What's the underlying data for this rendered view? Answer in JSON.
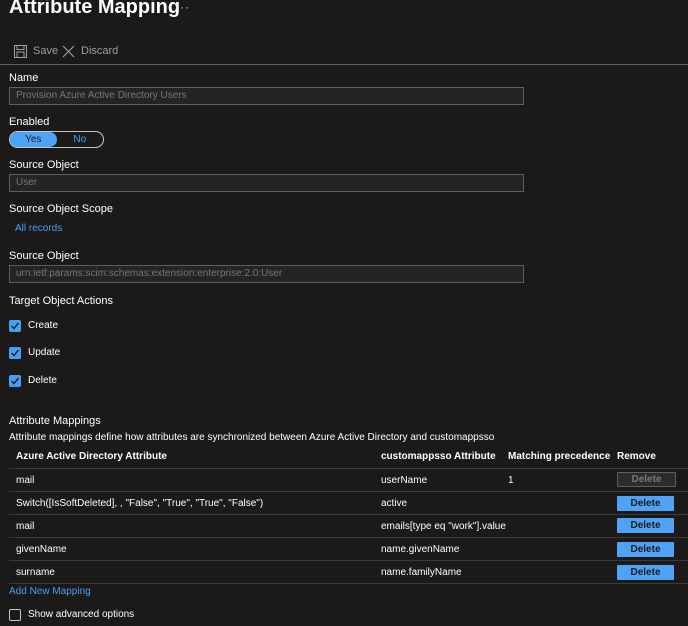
{
  "header": {
    "title": "Attribute Mapping",
    "more": "···"
  },
  "toolbar": {
    "save_label": "Save",
    "discard_label": "Discard"
  },
  "form": {
    "name": {
      "label": "Name",
      "value": "Provision Azure Active Directory Users"
    },
    "enabled": {
      "label": "Enabled",
      "yes": "Yes",
      "no": "No",
      "selected": "Yes"
    },
    "source_object": {
      "label": "Source Object",
      "value": "User"
    },
    "scope": {
      "label": "Source Object Scope",
      "link": "All records"
    },
    "target_object": {
      "label": "Source Object",
      "value": "urn:ietf:params:scim:schemas:extension:enterprise:2.0:User"
    },
    "actions": {
      "label": "Target Object Actions",
      "items": [
        {
          "label": "Create",
          "checked": true
        },
        {
          "label": "Update",
          "checked": true
        },
        {
          "label": "Delete",
          "checked": true
        }
      ]
    }
  },
  "mappings": {
    "heading": "Attribute Mappings",
    "description": "Attribute mappings define how attributes are synchronized between Azure Active Directory and customappsso",
    "columns": [
      "Azure Active Directory Attribute",
      "customappsso Attribute",
      "Matching precedence",
      "Remove"
    ],
    "rows": [
      {
        "source": "mail",
        "target": "userName",
        "precedence": "1",
        "action": "Delete",
        "disabled": true
      },
      {
        "source": "Switch([IsSoftDeleted], , \"False\", \"True\", \"True\", \"False\")",
        "target": "active",
        "precedence": "",
        "action": "Delete",
        "disabled": false
      },
      {
        "source": "mail",
        "target": "emails[type eq \"work\"].value",
        "precedence": "",
        "action": "Delete",
        "disabled": false
      },
      {
        "source": "givenName",
        "target": "name.givenName",
        "precedence": "",
        "action": "Delete",
        "disabled": false
      },
      {
        "source": "surname",
        "target": "name.familyName",
        "precedence": "",
        "action": "Delete",
        "disabled": false
      }
    ],
    "add_link": "Add New Mapping"
  },
  "advanced": {
    "label": "Show advanced options",
    "checked": false
  },
  "colors": {
    "accent": "#4fa3f7",
    "link": "#479ef5",
    "background": "#1b1a19"
  }
}
